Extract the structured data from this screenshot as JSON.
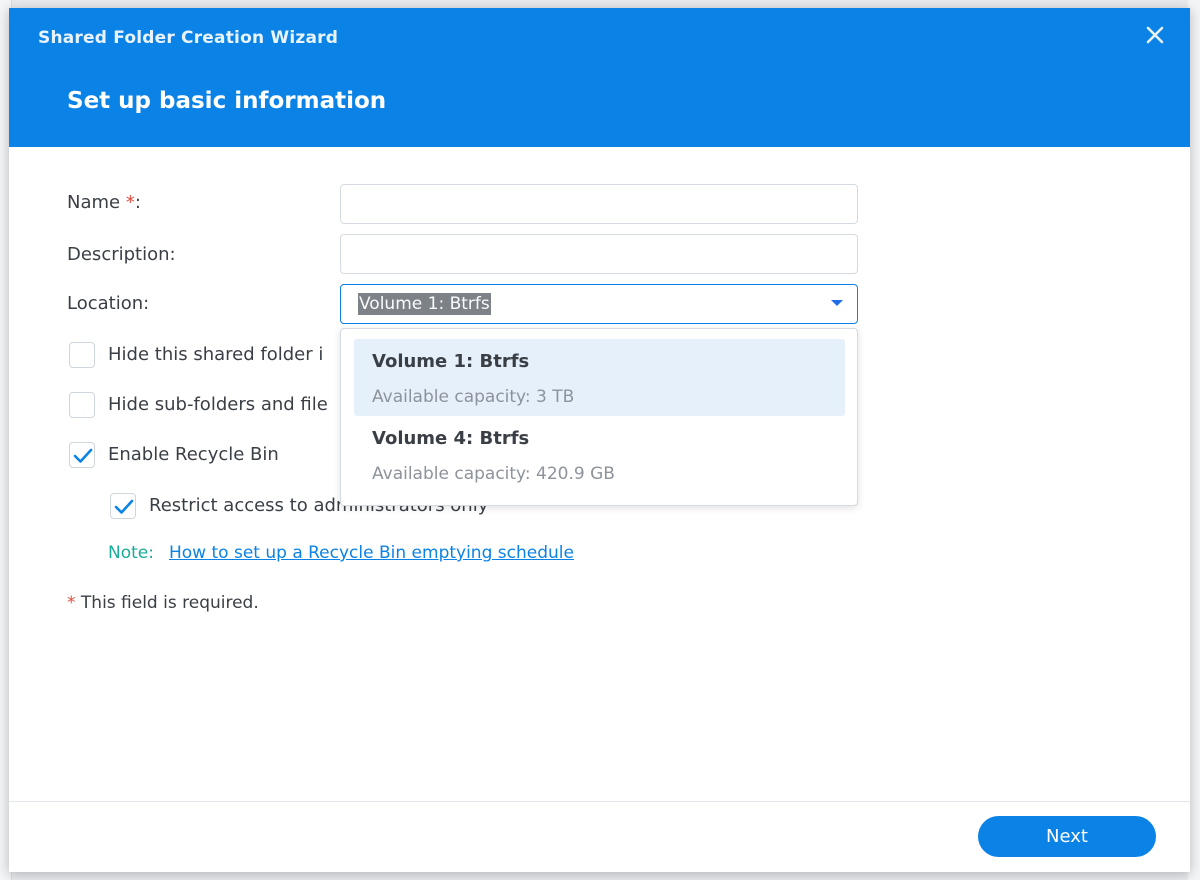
{
  "dialog": {
    "window_title": "Shared Folder Creation Wizard",
    "page_title": "Set up basic information",
    "close_icon": "close-icon"
  },
  "form": {
    "name_label": "Name",
    "required_mark": "*",
    "colon": ":",
    "name_value": "",
    "description_label": "Description:",
    "description_value": "",
    "location_label": "Location:",
    "location_selected": "Volume 1:  Btrfs",
    "location_caret_icon": "caret-down-icon"
  },
  "dropdown": {
    "options": [
      {
        "name": "Volume 1: Btrfs",
        "capacity": "Available capacity: 3 TB",
        "selected": true
      },
      {
        "name": "Volume 4: Btrfs",
        "capacity": "Available capacity: 420.9 GB",
        "selected": false
      }
    ]
  },
  "checkboxes": {
    "hide_folder": {
      "label": "Hide this shared folder i",
      "checked": false
    },
    "hide_subfolders": {
      "label": "Hide sub-folders and file",
      "checked": false
    },
    "recycle_bin": {
      "label": "Enable Recycle Bin",
      "checked": true
    },
    "restrict_admin": {
      "label": "Restrict access to administrators only",
      "checked": true
    }
  },
  "note": {
    "prefix": "Note:",
    "link_text": "How to set up a Recycle Bin emptying schedule"
  },
  "required_note": {
    "mark": "*",
    "text": " This field is required."
  },
  "footer": {
    "next_label": "Next"
  },
  "colors": {
    "accent": "#0b83e6",
    "required": "#e54b3c",
    "note": "#1bab9a",
    "selected_option_bg": "#e6f0fb"
  }
}
